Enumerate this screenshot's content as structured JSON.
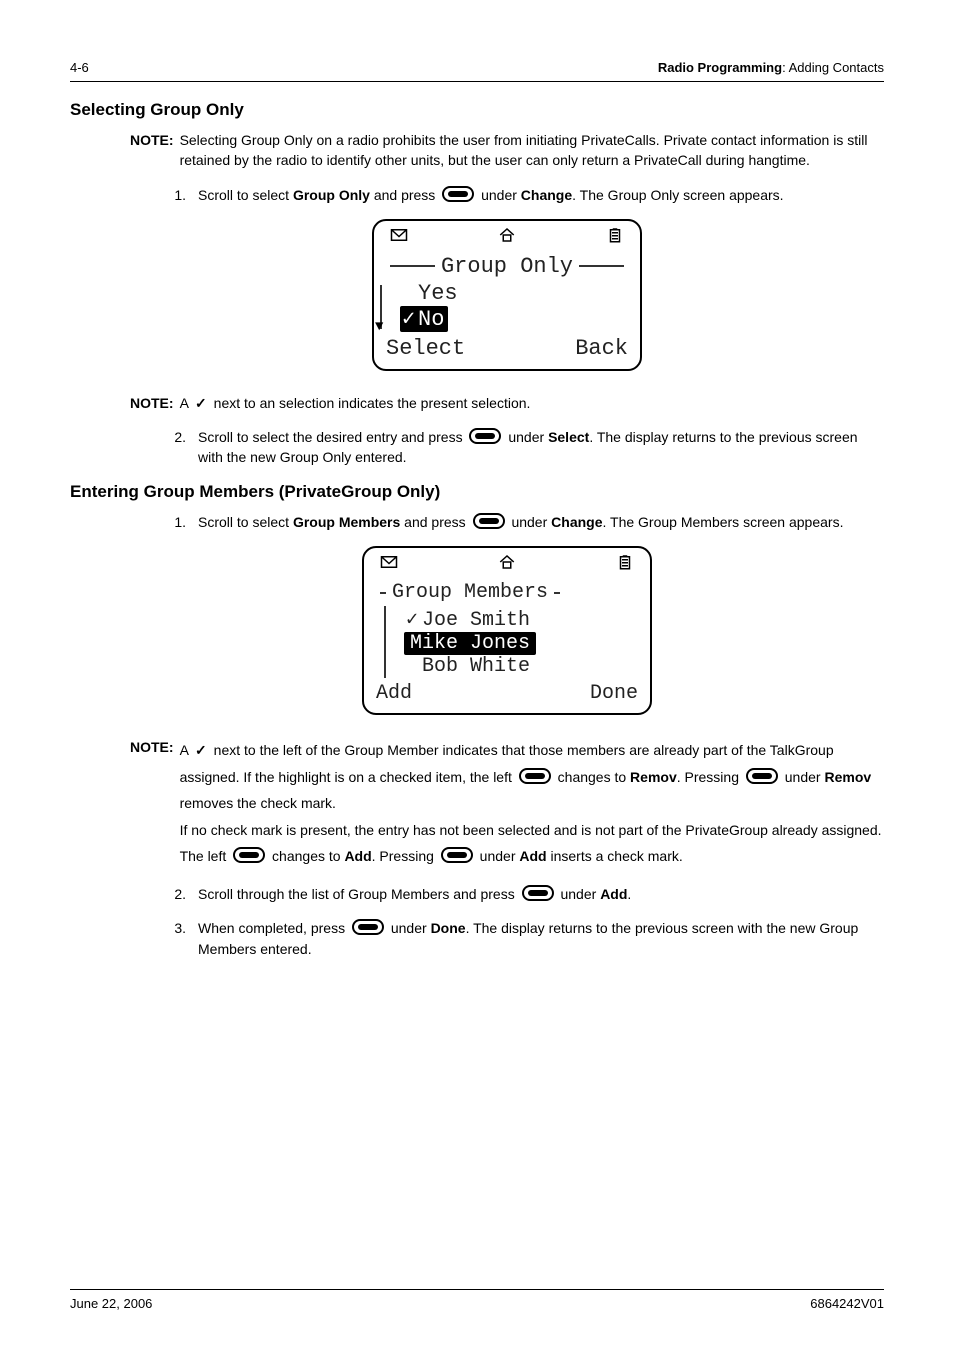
{
  "header": {
    "page_num": "4-6",
    "section": "Radio Programming",
    "subsection": "Adding Contacts"
  },
  "s1": {
    "heading": "Selecting Group Only",
    "note_label": "NOTE:",
    "note_text": "Selecting Group Only on a radio prohibits the user from initiating PrivateCalls. Private contact information is still retained by the radio to identify other units, but the user can only return a PrivateCall during hangtime.",
    "step1_num": "1.",
    "step1_a": "Scroll to select ",
    "step1_b": "Group Only",
    "step1_c": " and press ",
    "step1_d": " under ",
    "step1_e": "Change",
    "step1_f": ". The Group Only screen appears.",
    "lcd1": {
      "title": "Group Only",
      "opt1": "Yes",
      "opt2": "No",
      "left": "Select",
      "right": "Back"
    },
    "note2_label": "NOTE:",
    "note2_a": "A ",
    "note2_b": " next to an selection indicates the present selection.",
    "step2_num": "2.",
    "step2_a": "Scroll to select the desired entry and press ",
    "step2_b": " under ",
    "step2_c": "Select",
    "step2_d": ". The display returns to the previous screen with the new Group Only entered."
  },
  "s2": {
    "heading": "Entering Group Members (PrivateGroup Only)",
    "step1_num": "1.",
    "step1_a": "Scroll to select ",
    "step1_b": "Group Members",
    "step1_c": " and press ",
    "step1_d": " under ",
    "step1_e": "Change",
    "step1_f": ". The Group Members screen appears.",
    "lcd2": {
      "title": "Group Members",
      "opt1": "Joe Smith",
      "opt2": "Mike Jones",
      "opt3": "Bob White",
      "left": "Add",
      "right": "Done"
    },
    "note_label": "NOTE:",
    "note_a": "A ",
    "note_b": " next to the left of the Group Member indicates that those members are already part of the TalkGroup assigned. If the highlight is on a checked item, the left ",
    "note_c": " changes to ",
    "note_d": "Remov",
    "note_e": ". Pressing ",
    "note_f": " under ",
    "note_g": "Remov",
    "note_h": " removes the check mark.",
    "note_i": "If no check mark is present, the entry has not been selected and is not part of the PrivateGroup already assigned. The left ",
    "note_j": " changes to ",
    "note_k": "Add",
    "note_l": ". Pressing ",
    "note_m": " under ",
    "note_n": "Add",
    "note_o": " inserts a check mark.",
    "step2_num": "2.",
    "step2_a": "Scroll through the list of Group Members and press ",
    "step2_b": " under ",
    "step2_c": "Add",
    "step2_d": ".",
    "step3_num": "3.",
    "step3_a": "When completed, press ",
    "step3_b": " under ",
    "step3_c": "Done",
    "step3_d": ". The display returns to the previous screen with the new Group Members entered."
  },
  "footer": {
    "date": "June 22, 2006",
    "doc": "6864242V01"
  }
}
